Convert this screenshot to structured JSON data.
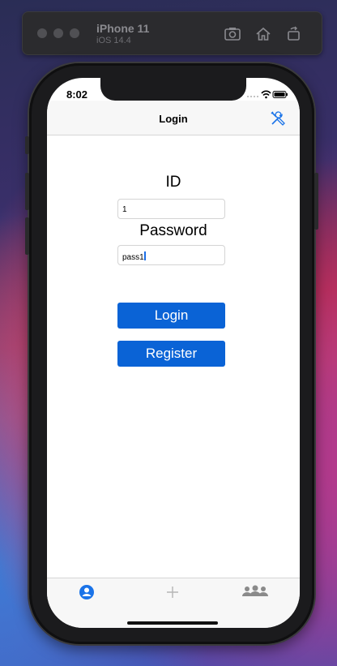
{
  "simulator": {
    "device_name": "iPhone 11",
    "os_version": "iOS 14.4",
    "toolbar_icons": [
      "screenshot-icon",
      "home-icon",
      "rotate-icon"
    ]
  },
  "status_bar": {
    "time": "8:02",
    "icons": [
      "signal-icon",
      "wifi-icon",
      "battery-icon"
    ]
  },
  "navbar": {
    "title": "Login",
    "right_icon": "tools-icon"
  },
  "form": {
    "id_label": "ID",
    "id_value": "1",
    "password_label": "Password",
    "password_value": "pass1"
  },
  "buttons": {
    "login": "Login",
    "register": "Register"
  },
  "tabbar": {
    "tabs": [
      {
        "icon": "person-icon",
        "active": true
      },
      {
        "icon": "plus-icon",
        "active": false
      },
      {
        "icon": "group-icon",
        "active": false
      }
    ]
  },
  "colors": {
    "accent": "#0a63d6",
    "active_tab": "#1a73e8",
    "inactive_tab": "#b5b5b5"
  }
}
